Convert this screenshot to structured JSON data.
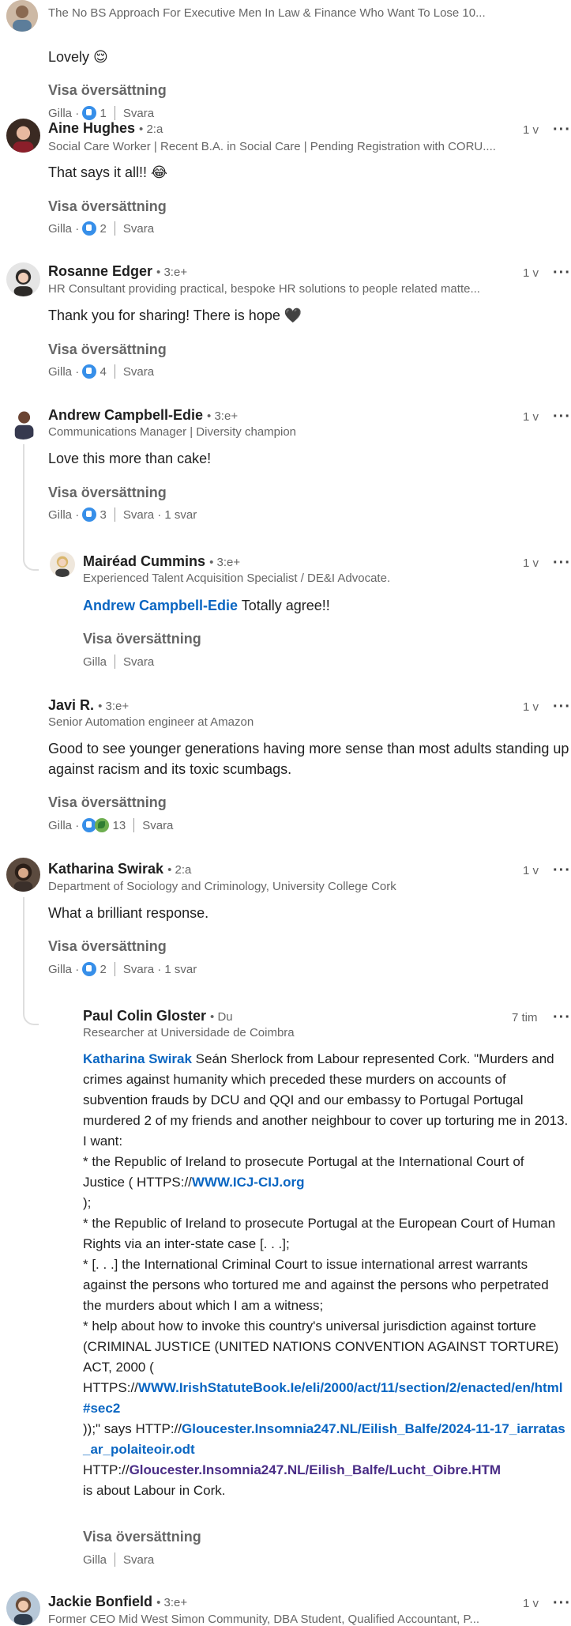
{
  "ui": {
    "translate": "Visa översättning",
    "like": "Gilla",
    "reply": "Svara",
    "dot": "·",
    "more": "···"
  },
  "top": {
    "headline": "The No BS Approach For Executive Men In Law & Finance Who Want To Lose 10...",
    "text": "Lovely 😌",
    "likes": "1"
  },
  "comments": [
    {
      "name": "Aine Hughes",
      "degree": "• 2:a",
      "headline": "Social Care Worker | Recent B.A. in Social Care | Pending Registration with CORU....",
      "time": "1 v",
      "text": "That says it all!! 😂",
      "likes": "2"
    },
    {
      "name": "Rosanne Edger",
      "degree": "• 3:e+",
      "headline": "HR Consultant providing practical, bespoke HR solutions to people related matte...",
      "time": "1 v",
      "text": "Thank you for sharing! There is hope 🖤",
      "likes": "4"
    },
    {
      "name": "Andrew Campbell-Edie",
      "degree": "• 3:e+",
      "headline": "Communications Manager | Diversity champion",
      "time": "1 v",
      "text": "Love this more than cake!",
      "likes": "3",
      "replies": "· 1 svar"
    },
    {
      "name": "Mairéad Cummins",
      "degree": "• 3:e+",
      "headline": "Experienced Talent Acquisition Specialist / DE&I Advocate.",
      "time": "1 v",
      "mention": "Andrew Campbell-Edie",
      "text": " Totally agree!!"
    },
    {
      "name": "Javi R.",
      "degree": "• 3:e+",
      "headline": "Senior Automation engineer at Amazon",
      "time": "1 v",
      "text": "Good to see younger generations having more sense than most adults standing up against racism and its toxic scumbags.",
      "likes": "13"
    },
    {
      "name": "Katharina Swirak",
      "degree": "• 2:a",
      "headline": "Department of Sociology and Criminology, University College Cork",
      "time": "1 v",
      "text": "What a brilliant response.",
      "likes": "2",
      "replies": "· 1 svar"
    },
    {
      "name": "Paul Colin Gloster",
      "degree": "• Du",
      "headline": "Researcher at Universidade de Coimbra",
      "time": "7 tim",
      "mention": "Katharina Swirak",
      "p1": " Seán Sherlock from Labour represented Cork. \"Murders and crimes against humanity which preceded these murders on accounts of subvention frauds by DCU and QQI and our embassy to Portugal Portugal murdered 2 of my friends and another neighbour to cover up torturing me in 2013. I want:",
      "p2a": "* the Republic of Ireland to prosecute Portugal at the International Court of Justice ( HTTPS://",
      "link1": "WWW.ICJ-CIJ.org",
      "p2b": ");",
      "p3": "* the Republic of Ireland to prosecute Portugal at the European Court of Human Rights via an inter-state case [. . .];",
      "p4": "* [. . .] the International Criminal Court to issue international arrest warrants against the persons who tortured me and against the persons who perpetrated the murders about which I am a witness;",
      "p5": "* help about how to invoke this country's universal jurisdiction against torture (CRIMINAL JUSTICE (UNITED NATIONS CONVENTION AGAINST TORTURE) ACT, 2000 (",
      "p6a": "HTTPS://",
      "link2": "WWW.IrishStatuteBook.Ie/eli/2000/act/11/section/2/enacted/en/html#sec2",
      "p7a": "));\" says HTTP://",
      "link3": "Gloucester.Insomnia247.NL/Eilish_Balfe/2024-11-17_iarratas_ar_polaiteoir.odt",
      "p8a": "HTTP://",
      "link4": "Gloucester.Insomnia247.NL/Eilish_Balfe/Lucht_Oibre.HTM",
      "p9": "is about Labour in Cork."
    },
    {
      "name": "Jackie Bonfield",
      "degree": "• 3:e+",
      "headline": "Former CEO Mid West Simon Community, DBA Student, Qualified Accountant, P...",
      "time": "1 v"
    }
  ],
  "colors": {
    "link": "#0a66c2",
    "visited_link": "#4a2d86",
    "like_icon": "#378fe9"
  },
  "icons": [
    "like-reaction-icon",
    "celebrate-reaction-icon",
    "more-options-icon"
  ]
}
